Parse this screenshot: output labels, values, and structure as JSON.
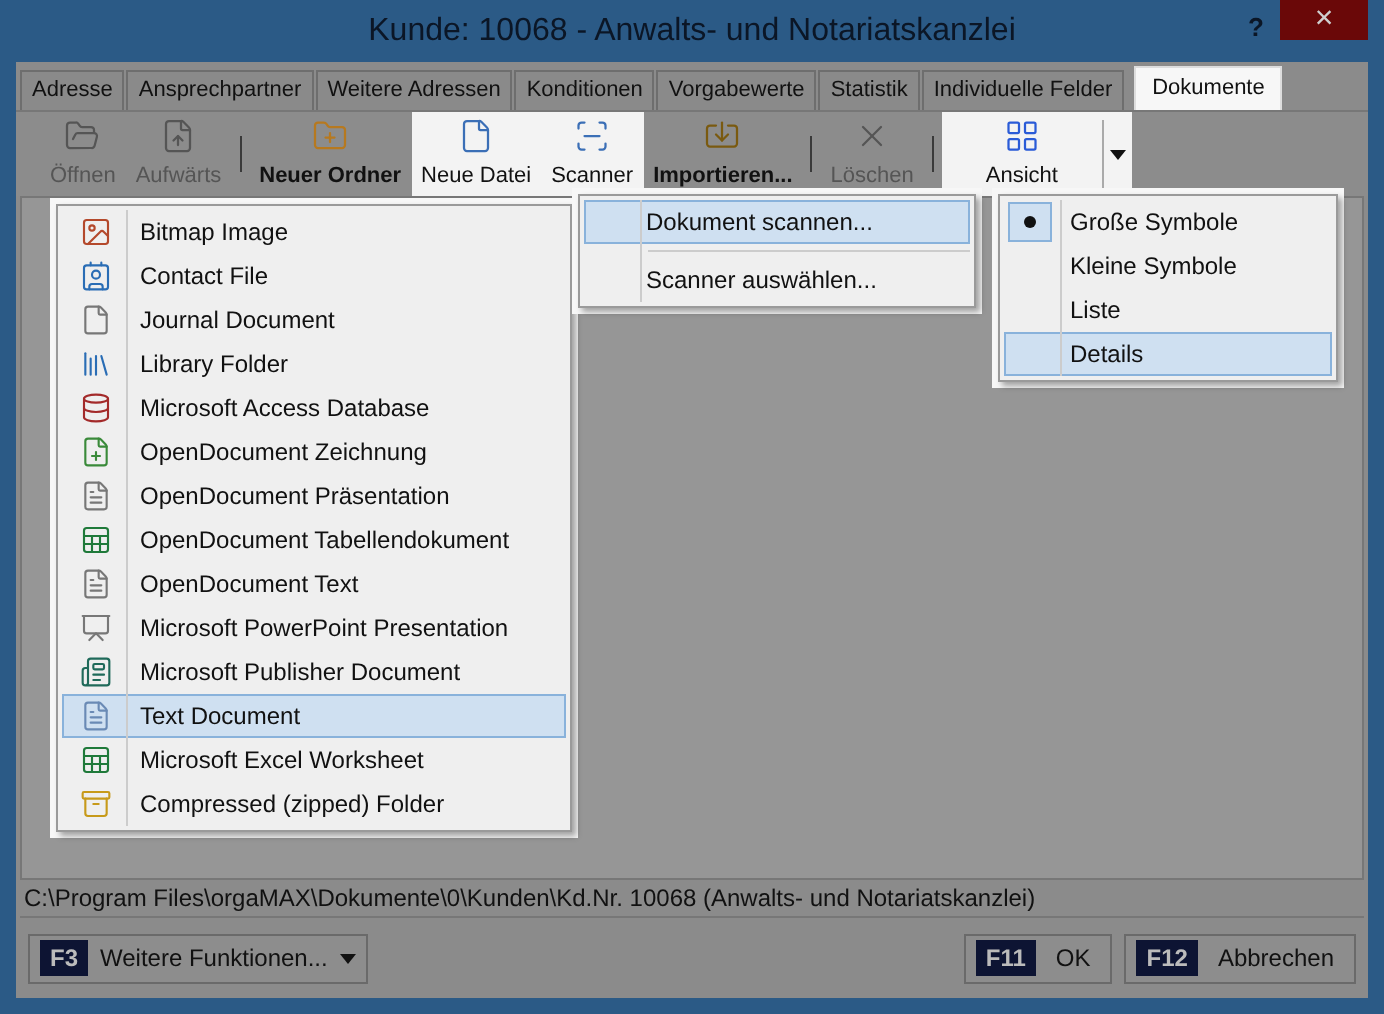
{
  "window": {
    "title": "Kunde: 10068 - Anwalts- und Notariatskanzlei",
    "help": "?",
    "close": "×"
  },
  "tabs": [
    {
      "label": "Adresse",
      "selected": false
    },
    {
      "label": "Ansprechpartner",
      "selected": false
    },
    {
      "label": "Weitere Adressen",
      "selected": false
    },
    {
      "label": "Konditionen",
      "selected": false
    },
    {
      "label": "Vorgabewerte",
      "selected": false
    },
    {
      "label": "Statistik",
      "selected": false
    },
    {
      "label": "Individuelle Felder",
      "selected": false
    },
    {
      "label": "Dokumente",
      "selected": true
    }
  ],
  "toolbar": [
    {
      "kind": "button",
      "label": "Öffnen",
      "disabled": true,
      "highlighted": false,
      "bold": false
    },
    {
      "kind": "button",
      "label": "Aufwärts",
      "disabled": true,
      "highlighted": false,
      "bold": false
    },
    {
      "kind": "separator"
    },
    {
      "kind": "button",
      "label": "Neuer Ordner",
      "disabled": false,
      "highlighted": false,
      "bold": true
    },
    {
      "kind": "button",
      "label": "Neue Datei",
      "disabled": false,
      "highlighted": true,
      "bold": false
    },
    {
      "kind": "button",
      "label": "Scanner",
      "disabled": false,
      "highlighted": true,
      "bold": false
    },
    {
      "kind": "button",
      "label": "Importieren...",
      "disabled": false,
      "highlighted": false,
      "bold": true
    },
    {
      "kind": "separator"
    },
    {
      "kind": "button",
      "label": "Löschen",
      "disabled": true,
      "highlighted": false,
      "bold": false
    },
    {
      "kind": "separator"
    },
    {
      "kind": "split",
      "label": "Ansicht",
      "highlighted": true
    }
  ],
  "new_file_menu": [
    {
      "label": "Bitmap Image",
      "selected": false
    },
    {
      "label": "Contact File",
      "selected": false
    },
    {
      "label": "Journal Document",
      "selected": false
    },
    {
      "label": "Library Folder",
      "selected": false
    },
    {
      "label": "Microsoft Access Database",
      "selected": false
    },
    {
      "label": "OpenDocument Zeichnung",
      "selected": false
    },
    {
      "label": "OpenDocument Präsentation",
      "selected": false
    },
    {
      "label": "OpenDocument Tabellendokument",
      "selected": false
    },
    {
      "label": "OpenDocument Text",
      "selected": false
    },
    {
      "label": "Microsoft PowerPoint Presentation",
      "selected": false
    },
    {
      "label": "Microsoft Publisher Document",
      "selected": false
    },
    {
      "label": "Text Document",
      "selected": true
    },
    {
      "label": "Microsoft Excel Worksheet",
      "selected": false
    },
    {
      "label": "Compressed (zipped) Folder",
      "selected": false
    }
  ],
  "scanner_menu": [
    {
      "label": "Dokument scannen...",
      "selected": true,
      "separator_before": false
    },
    {
      "label": "Scanner auswählen...",
      "selected": false,
      "separator_before": true
    }
  ],
  "view_menu": [
    {
      "label": "Große Symbole",
      "selected": false,
      "checked": true
    },
    {
      "label": "Kleine Symbole",
      "selected": false,
      "checked": false
    },
    {
      "label": "Liste",
      "selected": false,
      "checked": false
    },
    {
      "label": "Details",
      "selected": true,
      "checked": false
    }
  ],
  "status_bar": {
    "path": "C:\\Program Files\\orgaMAX\\Dokumente\\0\\Kunden\\Kd.Nr. 10068 (Anwalts- und Notariatskanzlei)"
  },
  "footer": {
    "left": [
      {
        "key": "F3",
        "label": "Weitere Funktionen..."
      }
    ],
    "right": [
      {
        "key": "F11",
        "label": "OK"
      },
      {
        "key": "F12",
        "label": "Abbrechen"
      }
    ]
  }
}
